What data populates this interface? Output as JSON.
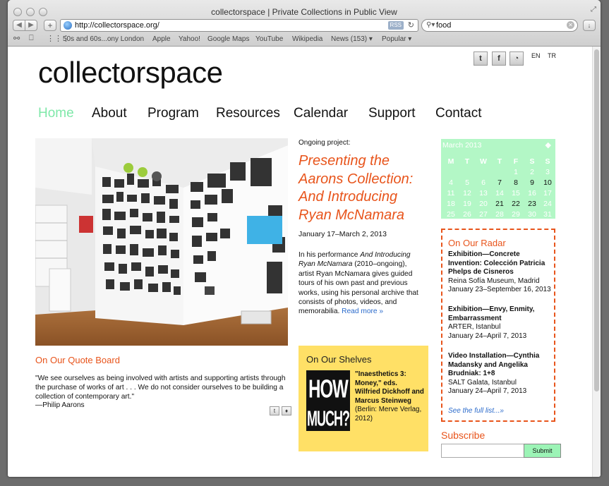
{
  "window": {
    "title": "collectorspace | Private Collections in Public View"
  },
  "browser": {
    "url": "http://collectorspace.org/",
    "rss_badge": "RSS",
    "search_value": "food",
    "bookmarks": [
      "50s and 60s...ony London",
      "Apple",
      "Yahoo!",
      "Google Maps",
      "YouTube",
      "Wikipedia",
      "News (153) ▾",
      "Popular ▾"
    ]
  },
  "site": {
    "logo": "collectorspace",
    "languages": [
      "EN",
      "TR"
    ],
    "social_icons": [
      "twitter-icon",
      "facebook-icon",
      "rss-icon"
    ],
    "nav": [
      "Home",
      "About",
      "Program",
      "Resources",
      "Calendar",
      "Support",
      "Contact"
    ],
    "nav_active": "Home",
    "accent_colors": {
      "orange": "#e8541b",
      "green": "#7fe8a9",
      "yellow": "#ffe066",
      "link": "#2a6acb"
    }
  },
  "feature": {
    "label": "Ongoing project:",
    "title": "Presenting the Aarons Collection: And Introducing Ryan McNamara",
    "date": "January 17–March 2, 2013",
    "body_1": "In his performance ",
    "body_em": "And Introducing Ryan McNamara",
    "body_2": " (2010–ongoing), artist Ryan McNamara gives guided tours of his own past and previous works, using his personal archive that consists of photos, videos, and memorabilia. ",
    "read_more": "Read more »"
  },
  "quote": {
    "heading": "On Our Quote Board",
    "text": "\"We see ourselves as being involved with artists and supporting artists through the purchase of works of art . . . We do not consider ourselves to be building a collection of contemporary art.\"",
    "author": "—Philip Aarons"
  },
  "shelves": {
    "heading": "On Our Shelves",
    "cover_lines": [
      "HOW",
      "MUCH?"
    ],
    "book_title": "\"Inaesthetics 3: Money,\" eds. Wilfried Dickhoff and Marcus Steinweg",
    "book_pub": " (Berlin: Merve Verlag, 2012)"
  },
  "calendar": {
    "month": "March 2013",
    "dow": [
      "M",
      "T",
      "W",
      "T",
      "F",
      "S",
      "S"
    ],
    "weeks": [
      [
        "",
        "",
        "",
        "",
        "1",
        "2",
        "3"
      ],
      [
        "4",
        "5",
        "6",
        "7",
        "8",
        "9",
        "10"
      ],
      [
        "11",
        "12",
        "13",
        "14",
        "15",
        "16",
        "17"
      ],
      [
        "18",
        "19",
        "20",
        "21",
        "22",
        "23",
        "24"
      ],
      [
        "25",
        "26",
        "27",
        "28",
        "29",
        "30",
        "31"
      ]
    ],
    "current_dates": [
      "7",
      "8",
      "9",
      "10",
      "21",
      "22",
      "23"
    ]
  },
  "radar": {
    "heading": "On Our Radar",
    "items": [
      {
        "title": "Exhibition—Concrete Invention: Colección Patricia Phelps de Cisneros",
        "venue": "Reina Sofía Museum, Madrid",
        "dates": "January 23–September 16, 2013"
      },
      {
        "title": "Exhibition—Envy, Enmity, Embarrassment",
        "venue": "ARTER, Istanbul",
        "dates": "January 24–April 7, 2013"
      },
      {
        "title": "Video Installation—Cynthia Madansky and Angelika Brudniak: 1+8",
        "venue": "SALT Galata, Istanbul",
        "dates": "January 24–April 7, 2013"
      }
    ],
    "more": "See the full list...»"
  },
  "subscribe": {
    "heading": "Subscribe",
    "input_value": "",
    "button": "Submit"
  }
}
